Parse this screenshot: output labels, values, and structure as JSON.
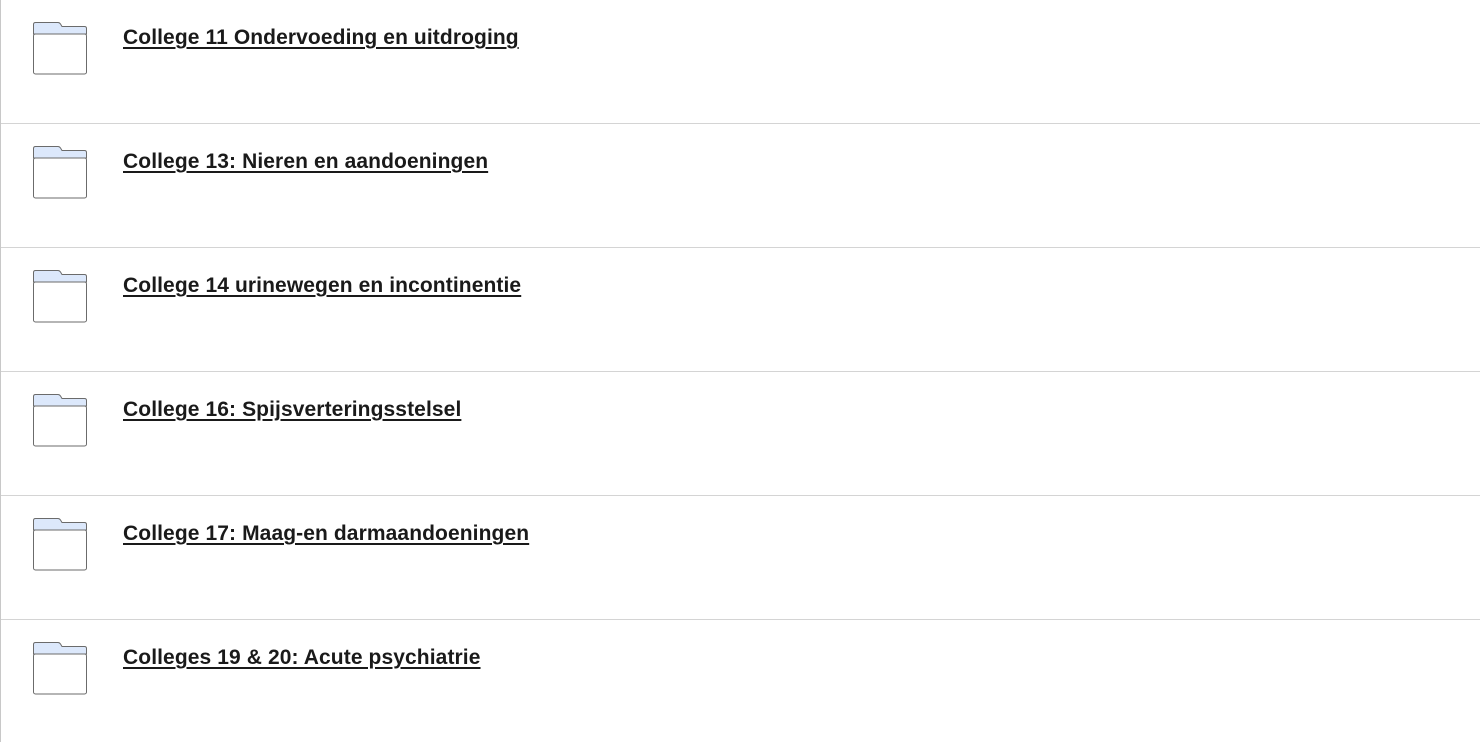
{
  "folders": [
    {
      "label": "College 11 Ondervoeding en uitdroging",
      "icon": "folder-icon"
    },
    {
      "label": "College 13: Nieren en aandoeningen",
      "icon": "folder-icon"
    },
    {
      "label": "College 14 urinewegen en incontinentie",
      "icon": "folder-icon"
    },
    {
      "label": "College 16: Spijsverteringsstelsel",
      "icon": "folder-icon"
    },
    {
      "label": "College 17: Maag-en darmaandoeningen",
      "icon": "folder-icon"
    },
    {
      "label": "Colleges 19 & 20: Acute psychiatrie",
      "icon": "folder-icon"
    }
  ],
  "colors": {
    "folder_fill": "#dce8fb",
    "folder_stroke": "#6b6b6b",
    "link_text": "#1a1a1a",
    "divider": "#d4d4d4"
  }
}
